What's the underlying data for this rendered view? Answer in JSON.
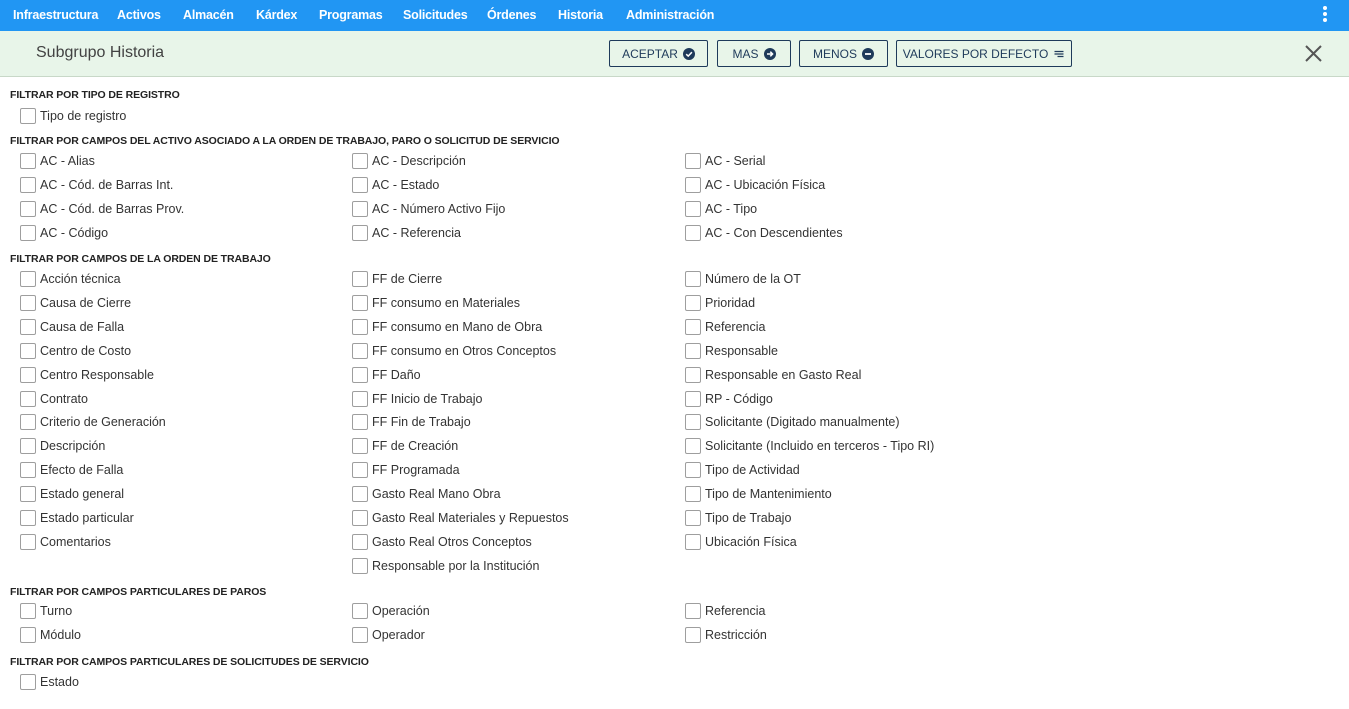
{
  "nav": {
    "items": [
      "Infraestructura",
      "Activos",
      "Almacén",
      "Kárdex",
      "Programas",
      "Solicitudes",
      "Órdenes",
      "Historia",
      "Administración"
    ]
  },
  "header": {
    "title": "Subgrupo Historia",
    "buttons": {
      "accept": "ACEPTAR",
      "more": "MAS",
      "less": "MENOS",
      "defaults": "VALORES POR DEFECTO"
    }
  },
  "sections": [
    {
      "title": "FILTRAR POR TIPO DE REGISTRO",
      "columns": [
        [
          "Tipo de registro"
        ]
      ]
    },
    {
      "title": "FILTRAR POR CAMPOS DEL ACTIVO ASOCIADO A LA ORDEN DE TRABAJO, PARO O SOLICITUD DE SERVICIO",
      "columns": [
        [
          "AC - Alias",
          "AC - Cód. de Barras Int.",
          "AC - Cód. de Barras Prov.",
          "AC - Código"
        ],
        [
          "AC - Descripción",
          "AC - Estado",
          "AC - Número Activo Fijo",
          "AC - Referencia"
        ],
        [
          "AC - Serial",
          "AC - Ubicación Física",
          "AC - Tipo",
          "AC - Con Descendientes"
        ]
      ]
    },
    {
      "title": "FILTRAR POR CAMPOS DE LA ORDEN DE TRABAJO",
      "columns": [
        [
          "Acción técnica",
          "Causa de Cierre",
          "Causa de Falla",
          "Centro de Costo",
          "Centro Responsable",
          "Contrato",
          "Criterio de Generación",
          "Descripción",
          "Efecto de Falla",
          "Estado general",
          "Estado particular",
          "Comentarios"
        ],
        [
          "FF de Cierre",
          "FF consumo en Materiales",
          "FF consumo en Mano de Obra",
          "FF consumo en Otros Conceptos",
          "FF Daño",
          "FF Inicio de Trabajo",
          "FF Fin de Trabajo",
          "FF de Creación",
          "FF Programada",
          "Gasto Real Mano Obra",
          "Gasto Real Materiales y Repuestos",
          "Gasto Real Otros Conceptos",
          "Responsable por la Institución"
        ],
        [
          "Número de la OT",
          "Prioridad",
          "Referencia",
          "Responsable",
          "Responsable en Gasto Real",
          "RP - Código",
          "Solicitante (Digitado manualmente)",
          "Solicitante (Incluido en terceros - Tipo RI)",
          "Tipo de Actividad",
          "Tipo de Mantenimiento",
          "Tipo de Trabajo",
          "Ubicación Física"
        ]
      ]
    },
    {
      "title": "FILTRAR POR CAMPOS PARTICULARES DE PAROS",
      "columns": [
        [
          "Turno",
          "Módulo"
        ],
        [
          "Operación",
          "Operador"
        ],
        [
          "Referencia",
          "Restricción"
        ]
      ]
    },
    {
      "title": "FILTRAR POR CAMPOS PARTICULARES DE SOLICITUDES DE SERVICIO",
      "columns": [
        [
          "Estado"
        ]
      ]
    }
  ],
  "colors": {
    "nav_bg": "#2196f3",
    "header_bg": "#e8f5e9",
    "button_border": "#1e3a5a"
  }
}
